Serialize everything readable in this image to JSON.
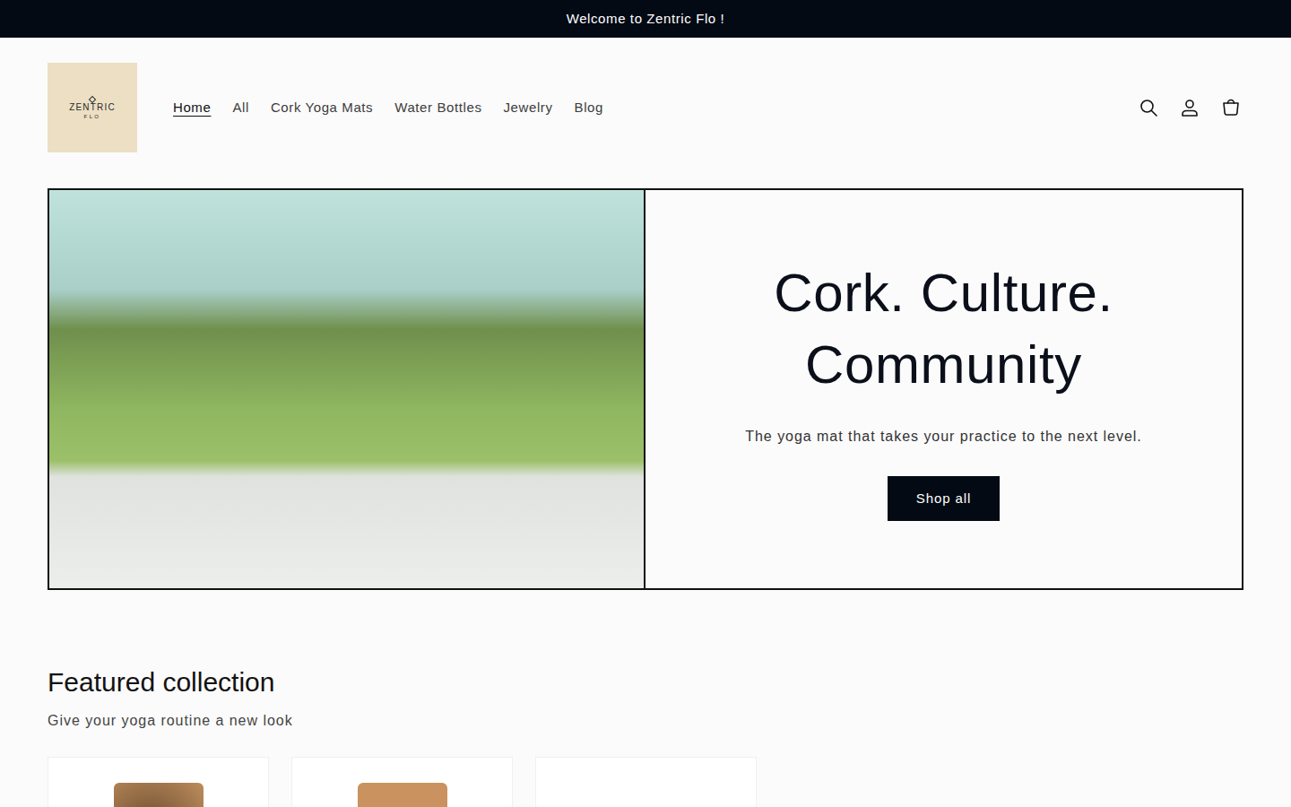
{
  "announcement": "Welcome to Zentric Flo !",
  "logo": {
    "name": "ZENTRIC",
    "sub": "FLO"
  },
  "nav": [
    {
      "label": "Home",
      "selected": true
    },
    {
      "label": "All",
      "selected": false
    },
    {
      "label": "Cork Yoga Mats",
      "selected": false
    },
    {
      "label": "Water Bottles",
      "selected": false
    },
    {
      "label": "Jewelry",
      "selected": false
    },
    {
      "label": "Blog",
      "selected": false
    }
  ],
  "hero": {
    "heading_lines": [
      "Cork. Culture.",
      "Community"
    ],
    "text": "The yoga mat that takes your practice to the next level.",
    "button": "Shop all"
  },
  "featured": {
    "title": "Featured collection",
    "subtitle": "Give your yoga routine a new look",
    "products": [
      {
        "kind": "patterned"
      },
      {
        "kind": "plain"
      },
      {
        "kind": "empty"
      }
    ]
  }
}
